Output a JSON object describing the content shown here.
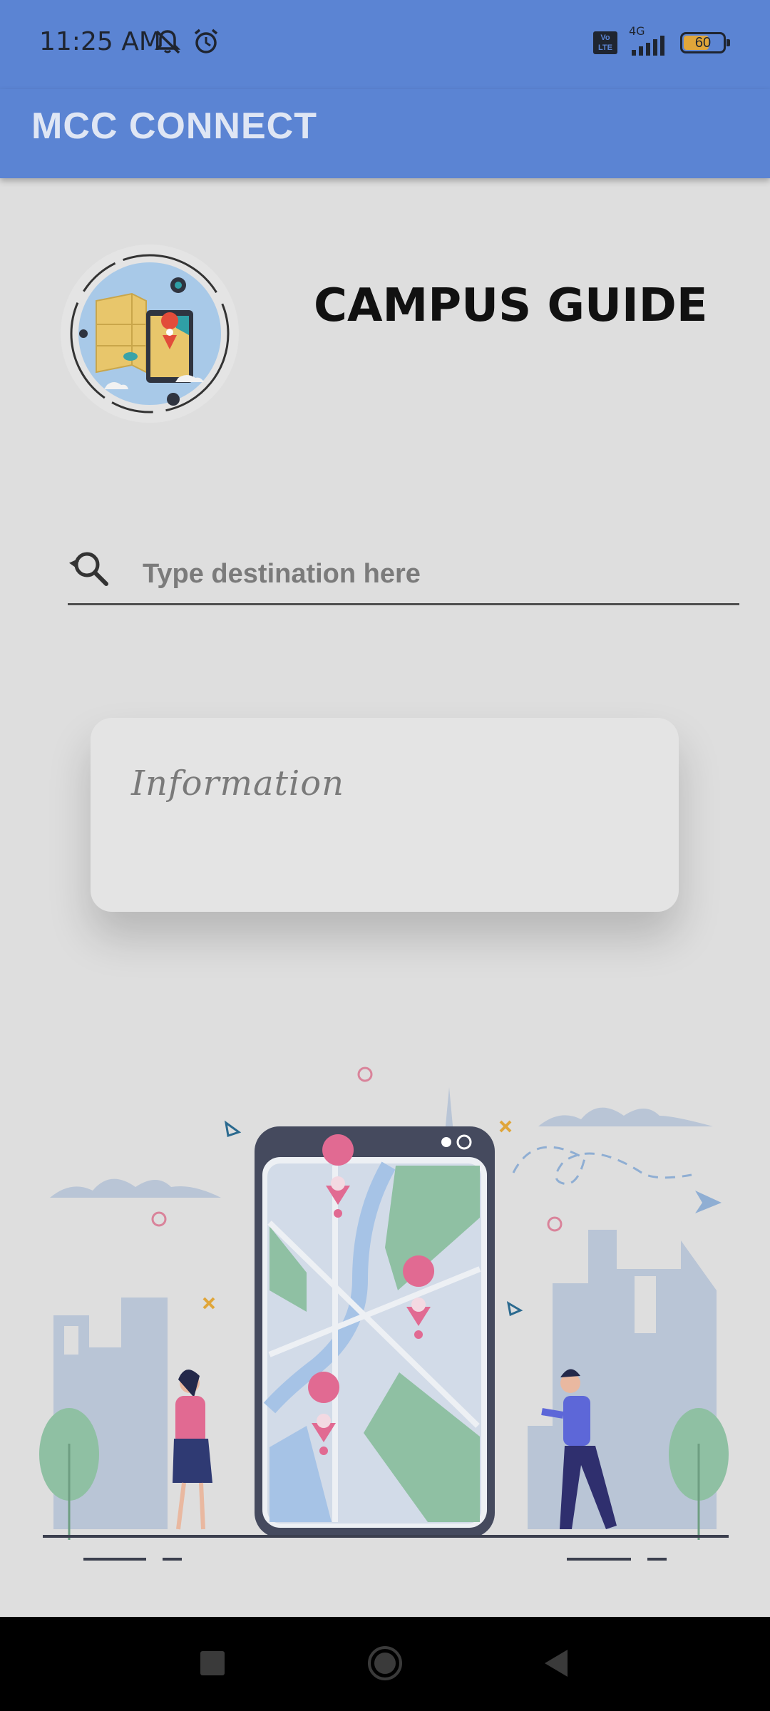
{
  "status_bar": {
    "time": "11:25 AM",
    "left_icons": [
      "bell-off-icon",
      "alarm-icon"
    ],
    "network_label": "4G",
    "volte_label": "Vo LTE",
    "battery_level": "60"
  },
  "app_bar": {
    "title": "MCC CONNECT"
  },
  "header": {
    "title": "CAMPUS GUIDE"
  },
  "search": {
    "placeholder": "Type destination here",
    "icon": "search-icon"
  },
  "info_card": {
    "label": "Information"
  },
  "nav_bar": {
    "buttons": [
      "recents-button",
      "home-button",
      "back-button"
    ]
  },
  "colors": {
    "accent": "#5b84d3",
    "background": "#dedede",
    "card": "#e4e4e4",
    "navbar": "#000000"
  }
}
